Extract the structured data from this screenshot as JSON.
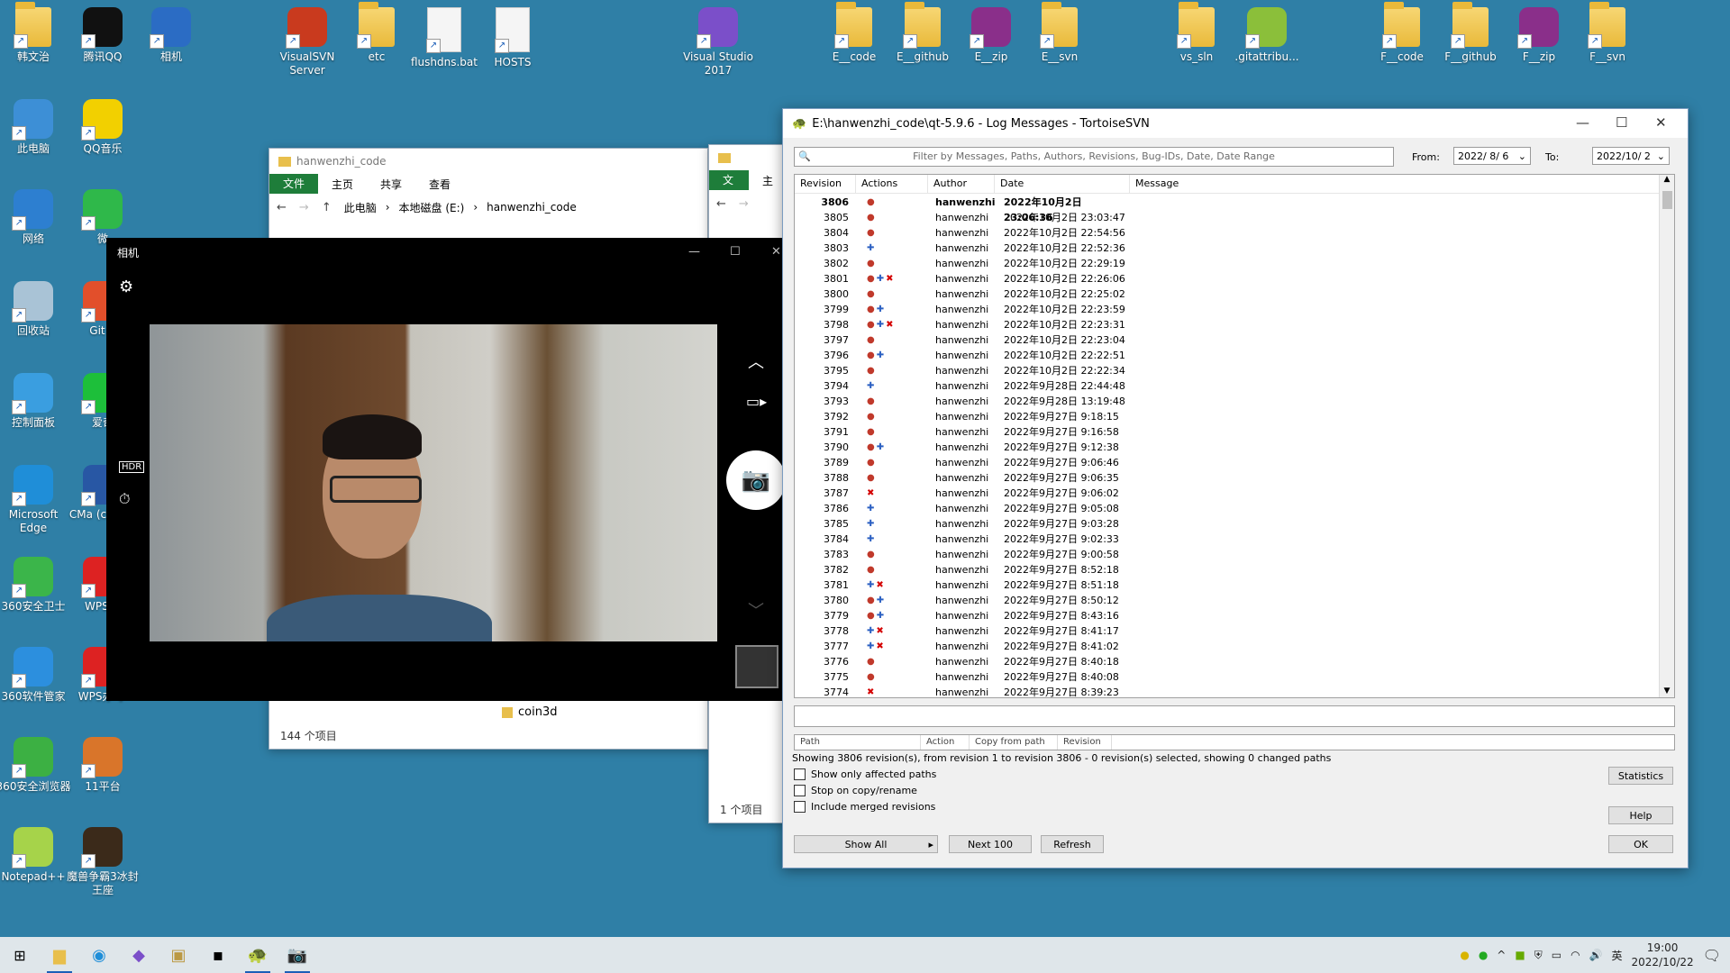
{
  "desktop": {
    "icons": [
      {
        "label": "韩文治",
        "icon": "folder"
      },
      {
        "label": "腾讯QQ",
        "icon": "qq-icon"
      },
      {
        "label": "相机",
        "icon": "camera-icon"
      },
      {
        "label": "VisualSVN Server",
        "icon": "visualsvn-icon"
      },
      {
        "label": "etc",
        "icon": "folder"
      },
      {
        "label": "flushdns.bat",
        "icon": "bat-file-icon"
      },
      {
        "label": "HOSTS",
        "icon": "file-icon"
      },
      {
        "label": "Visual Studio 2017",
        "icon": "visual-studio-icon"
      },
      {
        "label": "E__code",
        "icon": "folder"
      },
      {
        "label": "E__github",
        "icon": "folder"
      },
      {
        "label": "E__zip",
        "icon": "archive-icon"
      },
      {
        "label": "E__svn",
        "icon": "folder"
      },
      {
        "label": "vs_sln",
        "icon": "folder"
      },
      {
        "label": ".gitattribu...",
        "icon": "notepad-file-icon"
      },
      {
        "label": "F__code",
        "icon": "folder"
      },
      {
        "label": "F__github",
        "icon": "folder"
      },
      {
        "label": "F__zip",
        "icon": "archive-icon"
      },
      {
        "label": "F__svn",
        "icon": "folder"
      },
      {
        "label": "此电脑",
        "icon": "computer-icon"
      },
      {
        "label": "QQ音乐",
        "icon": "qq-music-icon"
      },
      {
        "label": "网络",
        "icon": "network-icon"
      },
      {
        "label": "微",
        "icon": "wechat-icon"
      },
      {
        "label": "回收站",
        "icon": "recycle-bin-icon"
      },
      {
        "label": "Git B",
        "icon": "git-icon"
      },
      {
        "label": "控制面板",
        "icon": "control-panel-icon"
      },
      {
        "label": "爱奇",
        "icon": "iqiyi-icon"
      },
      {
        "label": "Microsoft Edge",
        "icon": "edge-icon"
      },
      {
        "label": "CMa (cmake",
        "icon": "cmake-icon"
      },
      {
        "label": "360安全卫士",
        "icon": "security-360-icon"
      },
      {
        "label": "WPS O",
        "icon": "wps-icon"
      },
      {
        "label": "360软件管家",
        "icon": "software-manager-icon"
      },
      {
        "label": "WPS办 手",
        "icon": "wps-icon"
      },
      {
        "label": "360安全浏览器",
        "icon": "browser-360-icon"
      },
      {
        "label": "11平台",
        "icon": "game-platform-icon"
      },
      {
        "label": "Notepad++",
        "icon": "notepadpp-icon"
      },
      {
        "label": "魔兽争霸3冰封王座",
        "icon": "warcraft-icon"
      }
    ]
  },
  "explorer1": {
    "title": "hanwenzhi_code",
    "tabs": [
      "文件",
      "主页",
      "共享",
      "查看"
    ],
    "breadcrumb": [
      "此电脑",
      "本地磁盘 (E:)",
      "hanwenzhi_code"
    ],
    "item": "coin3d",
    "status": "144 个项目"
  },
  "explorer2": {
    "tabs": [
      "文件",
      "主"
    ],
    "status": "1 个项目"
  },
  "camera": {
    "title": "相机"
  },
  "svn": {
    "title": "E:\\hanwenzhi_code\\qt-5.9.6 - Log Messages - TortoiseSVN",
    "filter_placeholder": "Filter by Messages, Paths, Authors, Revisions, Bug-IDs, Date, Date Range",
    "from_label": "From:",
    "from_value": "2022/ 8/ 6",
    "to_label": "To:",
    "to_value": "2022/10/ 2",
    "columns": [
      "Revision",
      "Actions",
      "Author",
      "Date",
      "Message"
    ],
    "rows": [
      {
        "rev": "3806",
        "actions": "M",
        "author": "hanwenzhi",
        "date": "2022年10月2日 23:06:36"
      },
      {
        "rev": "3805",
        "actions": "M",
        "author": "hanwenzhi",
        "date": "2022年10月2日 23:03:47"
      },
      {
        "rev": "3804",
        "actions": "M",
        "author": "hanwenzhi",
        "date": "2022年10月2日 22:54:56"
      },
      {
        "rev": "3803",
        "actions": "A",
        "author": "hanwenzhi",
        "date": "2022年10月2日 22:52:36"
      },
      {
        "rev": "3802",
        "actions": "M",
        "author": "hanwenzhi",
        "date": "2022年10月2日 22:29:19"
      },
      {
        "rev": "3801",
        "actions": "MAD",
        "author": "hanwenzhi",
        "date": "2022年10月2日 22:26:06"
      },
      {
        "rev": "3800",
        "actions": "M",
        "author": "hanwenzhi",
        "date": "2022年10月2日 22:25:02"
      },
      {
        "rev": "3799",
        "actions": "MA",
        "author": "hanwenzhi",
        "date": "2022年10月2日 22:23:59"
      },
      {
        "rev": "3798",
        "actions": "MAD",
        "author": "hanwenzhi",
        "date": "2022年10月2日 22:23:31"
      },
      {
        "rev": "3797",
        "actions": "M",
        "author": "hanwenzhi",
        "date": "2022年10月2日 22:23:04"
      },
      {
        "rev": "3796",
        "actions": "MA",
        "author": "hanwenzhi",
        "date": "2022年10月2日 22:22:51"
      },
      {
        "rev": "3795",
        "actions": "M",
        "author": "hanwenzhi",
        "date": "2022年10月2日 22:22:34"
      },
      {
        "rev": "3794",
        "actions": "A",
        "author": "hanwenzhi",
        "date": "2022年9月28日 22:44:48"
      },
      {
        "rev": "3793",
        "actions": "M",
        "author": "hanwenzhi",
        "date": "2022年9月28日 13:19:48"
      },
      {
        "rev": "3792",
        "actions": "M",
        "author": "hanwenzhi",
        "date": "2022年9月27日 9:18:15"
      },
      {
        "rev": "3791",
        "actions": "M",
        "author": "hanwenzhi",
        "date": "2022年9月27日 9:16:58"
      },
      {
        "rev": "3790",
        "actions": "MA",
        "author": "hanwenzhi",
        "date": "2022年9月27日 9:12:38"
      },
      {
        "rev": "3789",
        "actions": "M",
        "author": "hanwenzhi",
        "date": "2022年9月27日 9:06:46"
      },
      {
        "rev": "3788",
        "actions": "M",
        "author": "hanwenzhi",
        "date": "2022年9月27日 9:06:35"
      },
      {
        "rev": "3787",
        "actions": "D",
        "author": "hanwenzhi",
        "date": "2022年9月27日 9:06:02"
      },
      {
        "rev": "3786",
        "actions": "A",
        "author": "hanwenzhi",
        "date": "2022年9月27日 9:05:08"
      },
      {
        "rev": "3785",
        "actions": "A",
        "author": "hanwenzhi",
        "date": "2022年9月27日 9:03:28"
      },
      {
        "rev": "3784",
        "actions": "A",
        "author": "hanwenzhi",
        "date": "2022年9月27日 9:02:33"
      },
      {
        "rev": "3783",
        "actions": "M",
        "author": "hanwenzhi",
        "date": "2022年9月27日 9:00:58"
      },
      {
        "rev": "3782",
        "actions": "M",
        "author": "hanwenzhi",
        "date": "2022年9月27日 8:52:18"
      },
      {
        "rev": "3781",
        "actions": "AD",
        "author": "hanwenzhi",
        "date": "2022年9月27日 8:51:18"
      },
      {
        "rev": "3780",
        "actions": "MA",
        "author": "hanwenzhi",
        "date": "2022年9月27日 8:50:12"
      },
      {
        "rev": "3779",
        "actions": "MA",
        "author": "hanwenzhi",
        "date": "2022年9月27日 8:43:16"
      },
      {
        "rev": "3778",
        "actions": "AD",
        "author": "hanwenzhi",
        "date": "2022年9月27日 8:41:17"
      },
      {
        "rev": "3777",
        "actions": "AD",
        "author": "hanwenzhi",
        "date": "2022年9月27日 8:41:02"
      },
      {
        "rev": "3776",
        "actions": "M",
        "author": "hanwenzhi",
        "date": "2022年9月27日 8:40:18"
      },
      {
        "rev": "3775",
        "actions": "M",
        "author": "hanwenzhi",
        "date": "2022年9月27日 8:40:08"
      },
      {
        "rev": "3774",
        "actions": "D",
        "author": "hanwenzhi",
        "date": "2022年9月27日 8:39:23"
      }
    ],
    "path_columns": [
      "Path",
      "Action",
      "Copy from path",
      "Revision"
    ],
    "summary": "Showing 3806 revision(s), from revision 1 to revision 3806 - 0 revision(s) selected, showing 0 changed paths",
    "checkboxes": [
      "Show only affected paths",
      "Stop on copy/rename",
      "Include merged revisions"
    ],
    "buttons": {
      "show_all": "Show All",
      "next": "Next 100",
      "refresh": "Refresh",
      "statistics": "Statistics",
      "help": "Help",
      "ok": "OK"
    }
  },
  "taskbar": {
    "time": "19:00",
    "date": "2022/10/22",
    "ime": "英"
  }
}
